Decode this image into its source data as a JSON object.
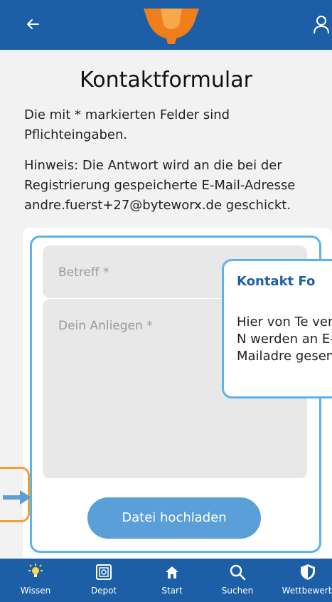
{
  "header": {
    "back_icon": "arrow-left-icon",
    "logo_icon": "trophy-logo",
    "user_icon": "user-icon"
  },
  "page": {
    "title": "Kontaktformular",
    "required_note": "Die mit * markierten Felder sind Pflichteingaben.",
    "hint": "Hinweis: Die Antwort wird an die bei der Registrierung gespeicherte E-Mail-Adresse andre.fuerst+27@byteworx.de geschickt."
  },
  "form": {
    "subject_placeholder": "Betreff *",
    "message_placeholder": "Dein Anliegen *",
    "upload_label": "Datei hochladen"
  },
  "tooltip": {
    "title": "Kontakt Fo",
    "body": "Hier von Te verfasste N werden an E-Mailadre gesendet."
  },
  "bottom_nav": {
    "items": [
      {
        "label": "Wissen",
        "icon": "lightbulb-icon"
      },
      {
        "label": "Depot",
        "icon": "safe-icon"
      },
      {
        "label": "Start",
        "icon": "home-icon"
      },
      {
        "label": "Suchen",
        "icon": "search-icon"
      },
      {
        "label": "Wettbewerb",
        "icon": "shield-icon"
      }
    ]
  },
  "colors": {
    "primary": "#1c5fa6",
    "accent_button": "#5b9fd9",
    "highlight_border": "#5bb3ee",
    "arrow": "#f0a030"
  }
}
